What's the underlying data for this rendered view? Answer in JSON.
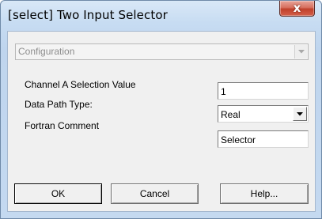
{
  "window": {
    "title": "[select] Two Input Selector",
    "close_glyph": "x"
  },
  "configuration": {
    "selected": "Configuration",
    "enabled": false
  },
  "fields": {
    "channel_a": {
      "label": "Channel A Selection Value",
      "value": "1"
    },
    "data_path_type": {
      "label": "Data Path Type:",
      "value": "Real"
    },
    "fortran_comment": {
      "label": "Fortran Comment",
      "value": "Selector"
    }
  },
  "buttons": {
    "ok": "OK",
    "cancel": "Cancel",
    "help": "Help..."
  },
  "icons": {
    "close": "close-icon",
    "dropdown": "chevron-down-icon"
  },
  "colors": {
    "title_bar": "#c7dcf2",
    "close_button": "#c0402b",
    "client_background": "#f0f0f0",
    "disabled_text": "#8d8d8d"
  }
}
